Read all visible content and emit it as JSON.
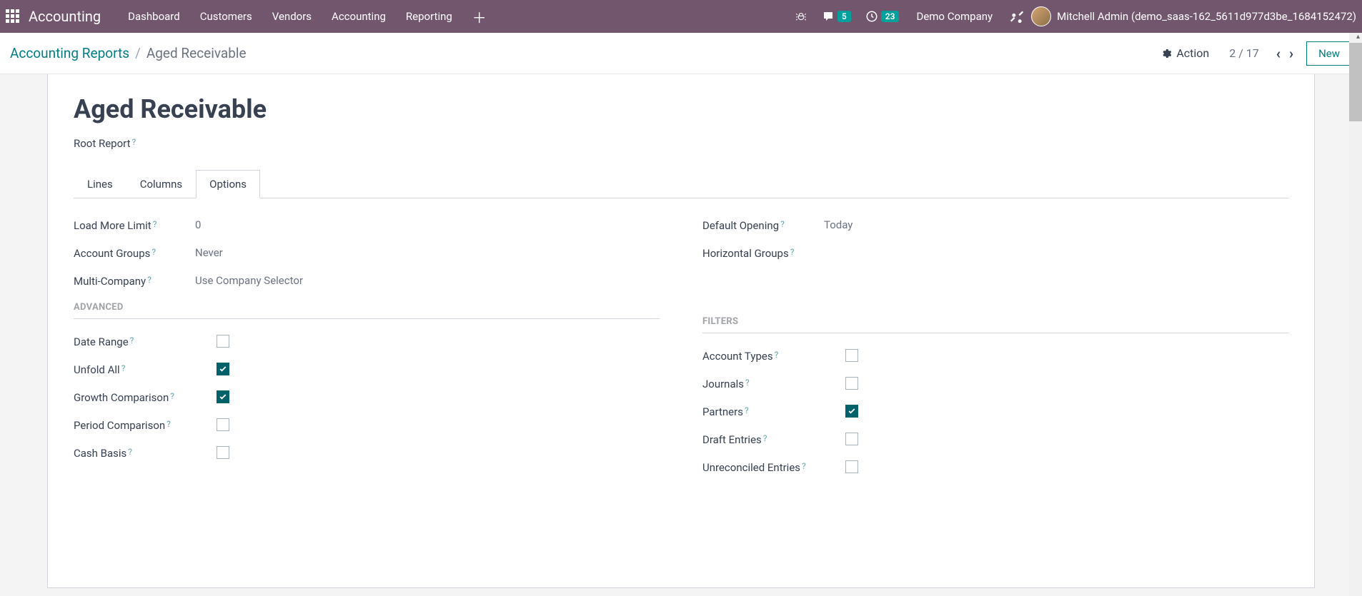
{
  "nav": {
    "brand": "Accounting",
    "links": [
      "Dashboard",
      "Customers",
      "Vendors",
      "Accounting",
      "Reporting"
    ],
    "messages_count": "5",
    "activities_count": "23",
    "company": "Demo Company",
    "user": "Mitchell Admin (demo_saas-162_5611d977d3be_1684152472)"
  },
  "breadcrumb": {
    "parent": "Accounting Reports",
    "current": "Aged Receivable",
    "action_label": "Action",
    "pager": "2 / 17",
    "new_label": "New"
  },
  "page": {
    "title": "Aged Receivable",
    "root_report_label": "Root Report",
    "tabs": {
      "lines": "Lines",
      "columns": "Columns",
      "options": "Options",
      "active": "options"
    }
  },
  "options": {
    "left": {
      "load_more_limit": {
        "label": "Load More Limit",
        "value": "0"
      },
      "account_groups": {
        "label": "Account Groups",
        "value": "Never"
      },
      "multi_company": {
        "label": "Multi-Company",
        "value": "Use Company Selector"
      }
    },
    "right": {
      "default_opening": {
        "label": "Default Opening",
        "value": "Today"
      },
      "horizontal_groups": {
        "label": "Horizontal Groups",
        "value": ""
      }
    }
  },
  "advanced": {
    "title": "ADVANCED",
    "items": [
      {
        "label": "Date Range",
        "checked": false
      },
      {
        "label": "Unfold All",
        "checked": true
      },
      {
        "label": "Growth Comparison",
        "checked": true
      },
      {
        "label": "Period Comparison",
        "checked": false
      },
      {
        "label": "Cash Basis",
        "checked": false
      }
    ]
  },
  "filters": {
    "title": "FILTERS",
    "items": [
      {
        "label": "Account Types",
        "checked": false
      },
      {
        "label": "Journals",
        "checked": false
      },
      {
        "label": "Partners",
        "checked": true
      },
      {
        "label": "Draft Entries",
        "checked": false
      },
      {
        "label": "Unreconciled Entries",
        "checked": false
      }
    ]
  }
}
